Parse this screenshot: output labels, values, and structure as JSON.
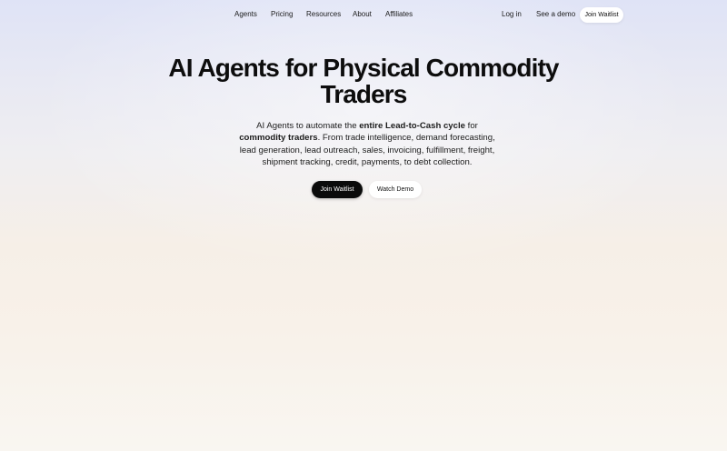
{
  "nav": {
    "links": [
      {
        "label": "Agents"
      },
      {
        "label": "Pricing"
      },
      {
        "label": "Resources"
      },
      {
        "label": "About"
      },
      {
        "label": "Affiliates"
      }
    ],
    "login_label": "Log in",
    "demo_label": "See a demo",
    "waitlist_label": "Join Waitlist"
  },
  "hero": {
    "title_line1": "AI Agents for Physical Commodity",
    "title_line2": "Traders",
    "desc": {
      "part1": "AI Agents to automate the ",
      "bold1": "entire Lead-to-Cash cycle",
      "part2": " for ",
      "bold2": "commodity traders",
      "part3": ". From trade intelligence, demand forecasting, lead generation, lead outreach, sales, invoicing, fulfillment, freight, shipment tracking, credit, payments, to debt collection."
    },
    "primary_cta": "Join Waitlist",
    "secondary_cta": "Watch Demo"
  },
  "colors": {
    "background_top": "#dfe3f6",
    "background_bottom": "#f9f6f1",
    "primary_button": "#0b0b0b",
    "secondary_button": "#ffffff"
  }
}
